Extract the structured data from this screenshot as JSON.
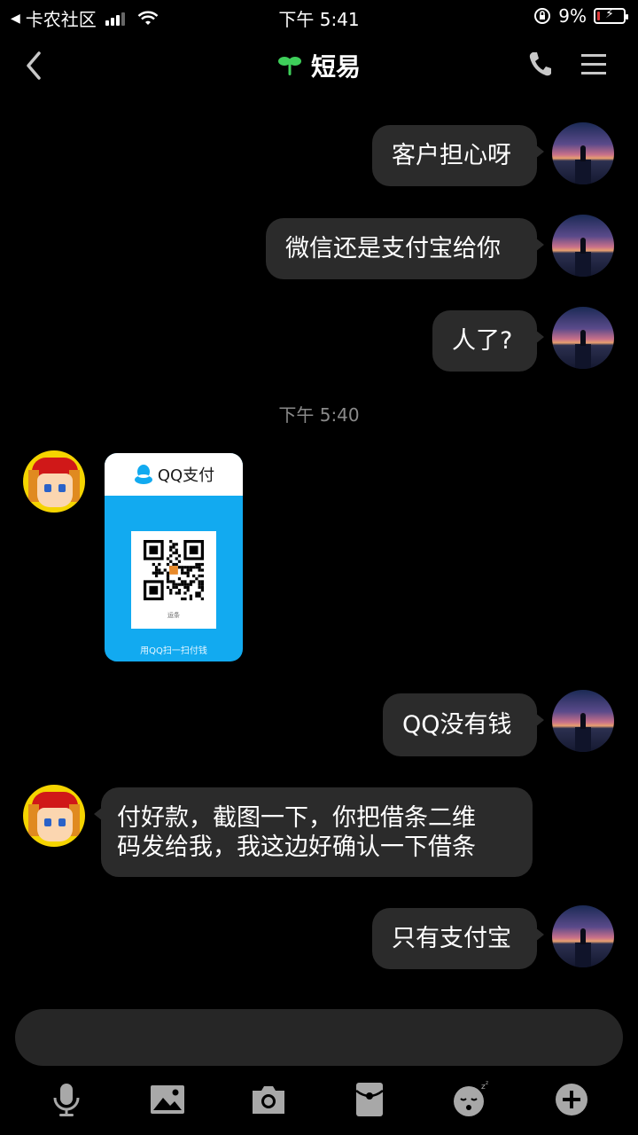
{
  "status_bar": {
    "back_app": "卡农社区",
    "time": "下午 5:41",
    "battery": "9%",
    "battery_level": 0.09,
    "battery_color": "#e03a3a"
  },
  "nav": {
    "title": "短易",
    "back_icon": "chevron-left-icon",
    "phone_icon": "phone-icon",
    "menu_icon": "menu-icon",
    "title_icon": "sprout-icon",
    "title_icon_color": "#3ecf5a"
  },
  "messages": [
    {
      "from": "me",
      "text": "客户担心呀"
    },
    {
      "from": "me",
      "text": "微信还是支付宝给你"
    },
    {
      "from": "me",
      "text": "人了?"
    },
    {
      "type": "timestamp",
      "text": "下午 5:40"
    },
    {
      "from": "them",
      "type": "qq-pay-card",
      "title": "QQ支付",
      "code_caption": "运条",
      "footer": "用QQ扫一扫付钱"
    },
    {
      "from": "me",
      "text": "QQ没有钱"
    },
    {
      "from": "them",
      "lines": [
        "付好款，截图一下，你把借条二维",
        "码发给我，我这边好确认一下借条"
      ]
    },
    {
      "from": "me",
      "text": "只有支付宝"
    }
  ],
  "input": {
    "value": "",
    "placeholder": ""
  },
  "toolbar": {
    "icons": [
      "microphone-icon",
      "image-icon",
      "camera-icon",
      "red-packet-icon",
      "emoji-icon",
      "plus-icon"
    ]
  },
  "colors": {
    "bubble": "#2b2b2b",
    "qq_blue": "#12aaf0",
    "background": "#000000"
  }
}
